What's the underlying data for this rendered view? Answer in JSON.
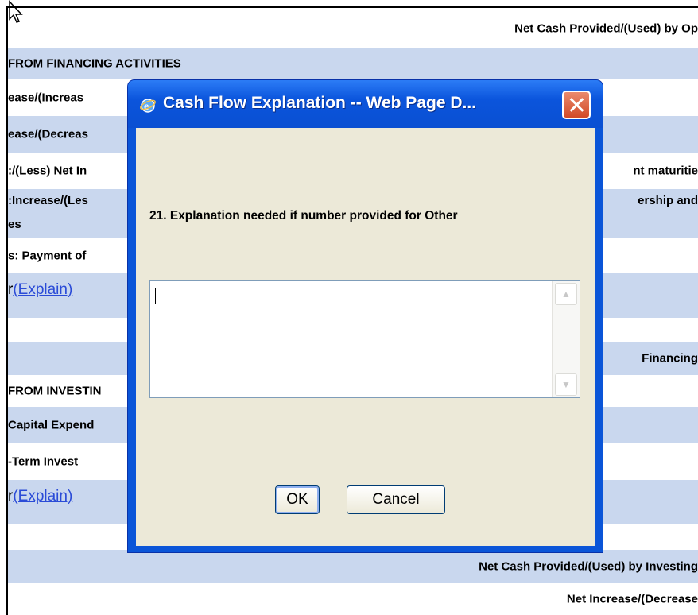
{
  "background": {
    "rows": [
      {
        "text": "Net Cash Provided/(Used) by Op",
        "align": "right"
      },
      {
        "text": "FROM FINANCING ACTIVITIES",
        "align": "left"
      },
      {
        "text": "ease/(Increas",
        "align": "left"
      },
      {
        "text": "ease/(Decreas",
        "align": "left"
      },
      {
        "text": ":/(Less) Net In",
        "right_text": "nt maturitie"
      },
      {
        "text": ":Increase/(Les",
        "text2": "es",
        "right_text": "ership and"
      },
      {
        "text": "s: Payment of"
      },
      {
        "text": "r",
        "link": "(Explain)"
      },
      {
        "text": ""
      },
      {
        "right_text": "Financing"
      },
      {
        "text": "FROM INVESTIN"
      },
      {
        "text": "Capital Expend"
      },
      {
        "text": "-Term Invest"
      },
      {
        "text": "r",
        "link": "(Explain)"
      },
      {
        "text": ""
      },
      {
        "right_text": "Net Cash Provided/(Used) by Investing"
      },
      {
        "right_text": "Net Increase/(Decrease"
      }
    ],
    "row_color": "#c9d7ee",
    "link_color": "#2a4bd7"
  },
  "dialog": {
    "title": "Cash Flow Explanation -- Web Page D...",
    "question": "21. Explanation needed if number provided for Other",
    "textarea_value": "",
    "ok_label": "OK",
    "cancel_label": "Cancel",
    "title_bar_color": "#0a55d8",
    "close_color": "#d24a26"
  }
}
